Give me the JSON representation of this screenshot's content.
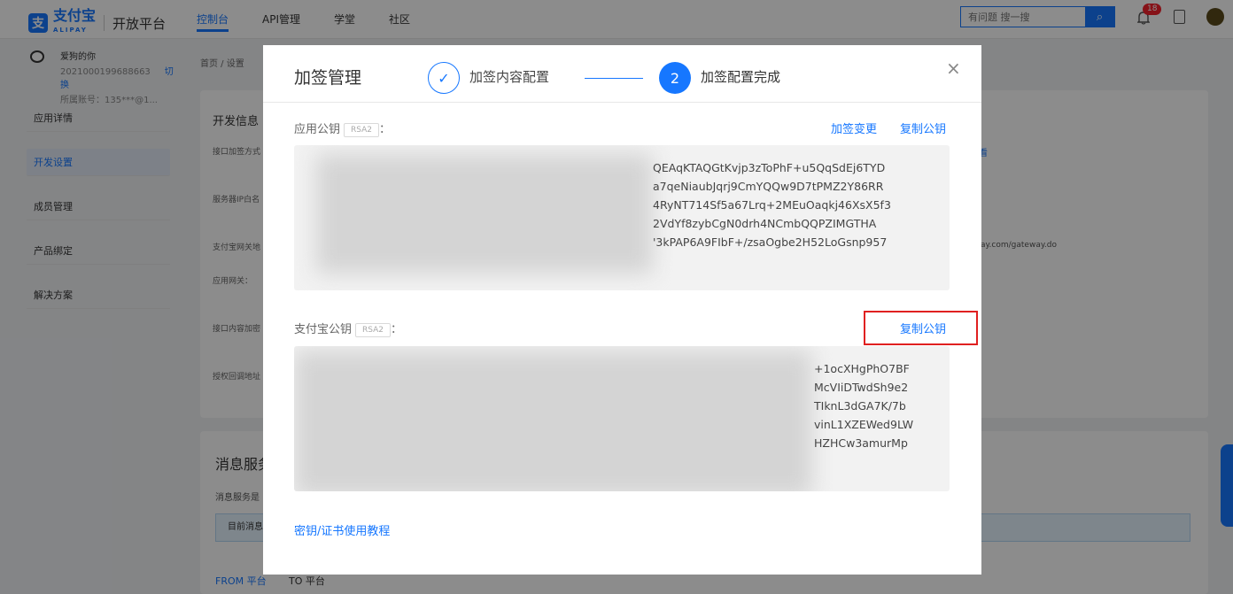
{
  "topbar": {
    "logo_text": "支付宝",
    "logo_sub": "ALIPAY",
    "platform": "开放平台",
    "nav": [
      "控制台",
      "API管理",
      "学堂",
      "社区"
    ],
    "search_placeholder": "有问题 搜一搜",
    "notification_count": "18"
  },
  "account": {
    "name": "爱狗的你",
    "id": "2021000199688663",
    "switch_label": "切换",
    "sub_account": "所属账号：135***@1..."
  },
  "sidebar": {
    "items": [
      "应用详情",
      "开发设置",
      "成员管理",
      "产品绑定",
      "解决方案"
    ],
    "active": "开发设置"
  },
  "background": {
    "breadcrumb": "首页 / 设置",
    "dev_info_title": "开发信息",
    "rows": [
      "接口加签方式",
      "服务器IP白名",
      "支付宝网关地",
      "应用网关：",
      "接口内容加密",
      "授权回调地址"
    ],
    "gateway_tail": "ay.com/gateway.do",
    "msg_title": "消息服务",
    "msg_sub": "消息服务是",
    "msg_box": "目前消息",
    "tab_from": "FROM 平台",
    "tab_to": "TO 平台"
  },
  "modal": {
    "title": "加签管理",
    "step1_icon": "✓",
    "step1_label": "加签内容配置",
    "step2_number": "2",
    "step2_label": "加签配置完成",
    "close_icon": "×",
    "app_key": {
      "label": "应用公钥",
      "tag": "RSA2",
      "colon": "：",
      "action_change": "加签变更",
      "action_copy": "复制公钥",
      "lines": [
        "QEAqKTAQGtKvjp3zToPhF+u5QqSdEj6TYD",
        "a7qeNiaubJqrj9CmYQQw9D7tPMZ2Y86RR",
        "4RyNT714Sf5a67Lrq+2MEuOaqkj46XsX5f3",
        "2VdYf8zybCgN0drh4NCmbQQPZIMGTHA",
        "'3kPAP6A9FIbF+/zsaOgbe2H52LoGsnp957"
      ]
    },
    "alipay_key": {
      "label": "支付宝公钥",
      "tag": "RSA2",
      "colon": "：",
      "action_copy": "复制公钥",
      "lines": [
        "+1ocXHgPhO7BF",
        "McVIiDTwdSh9e2",
        "TIknL3dGA7K/7b",
        "vinL1XZEWed9LW",
        "HZHCw3amurMp"
      ]
    },
    "tutorial_link": "密钥/证书使用教程"
  },
  "colors": {
    "accent": "#1677ff",
    "highlight_border": "#e02020"
  }
}
